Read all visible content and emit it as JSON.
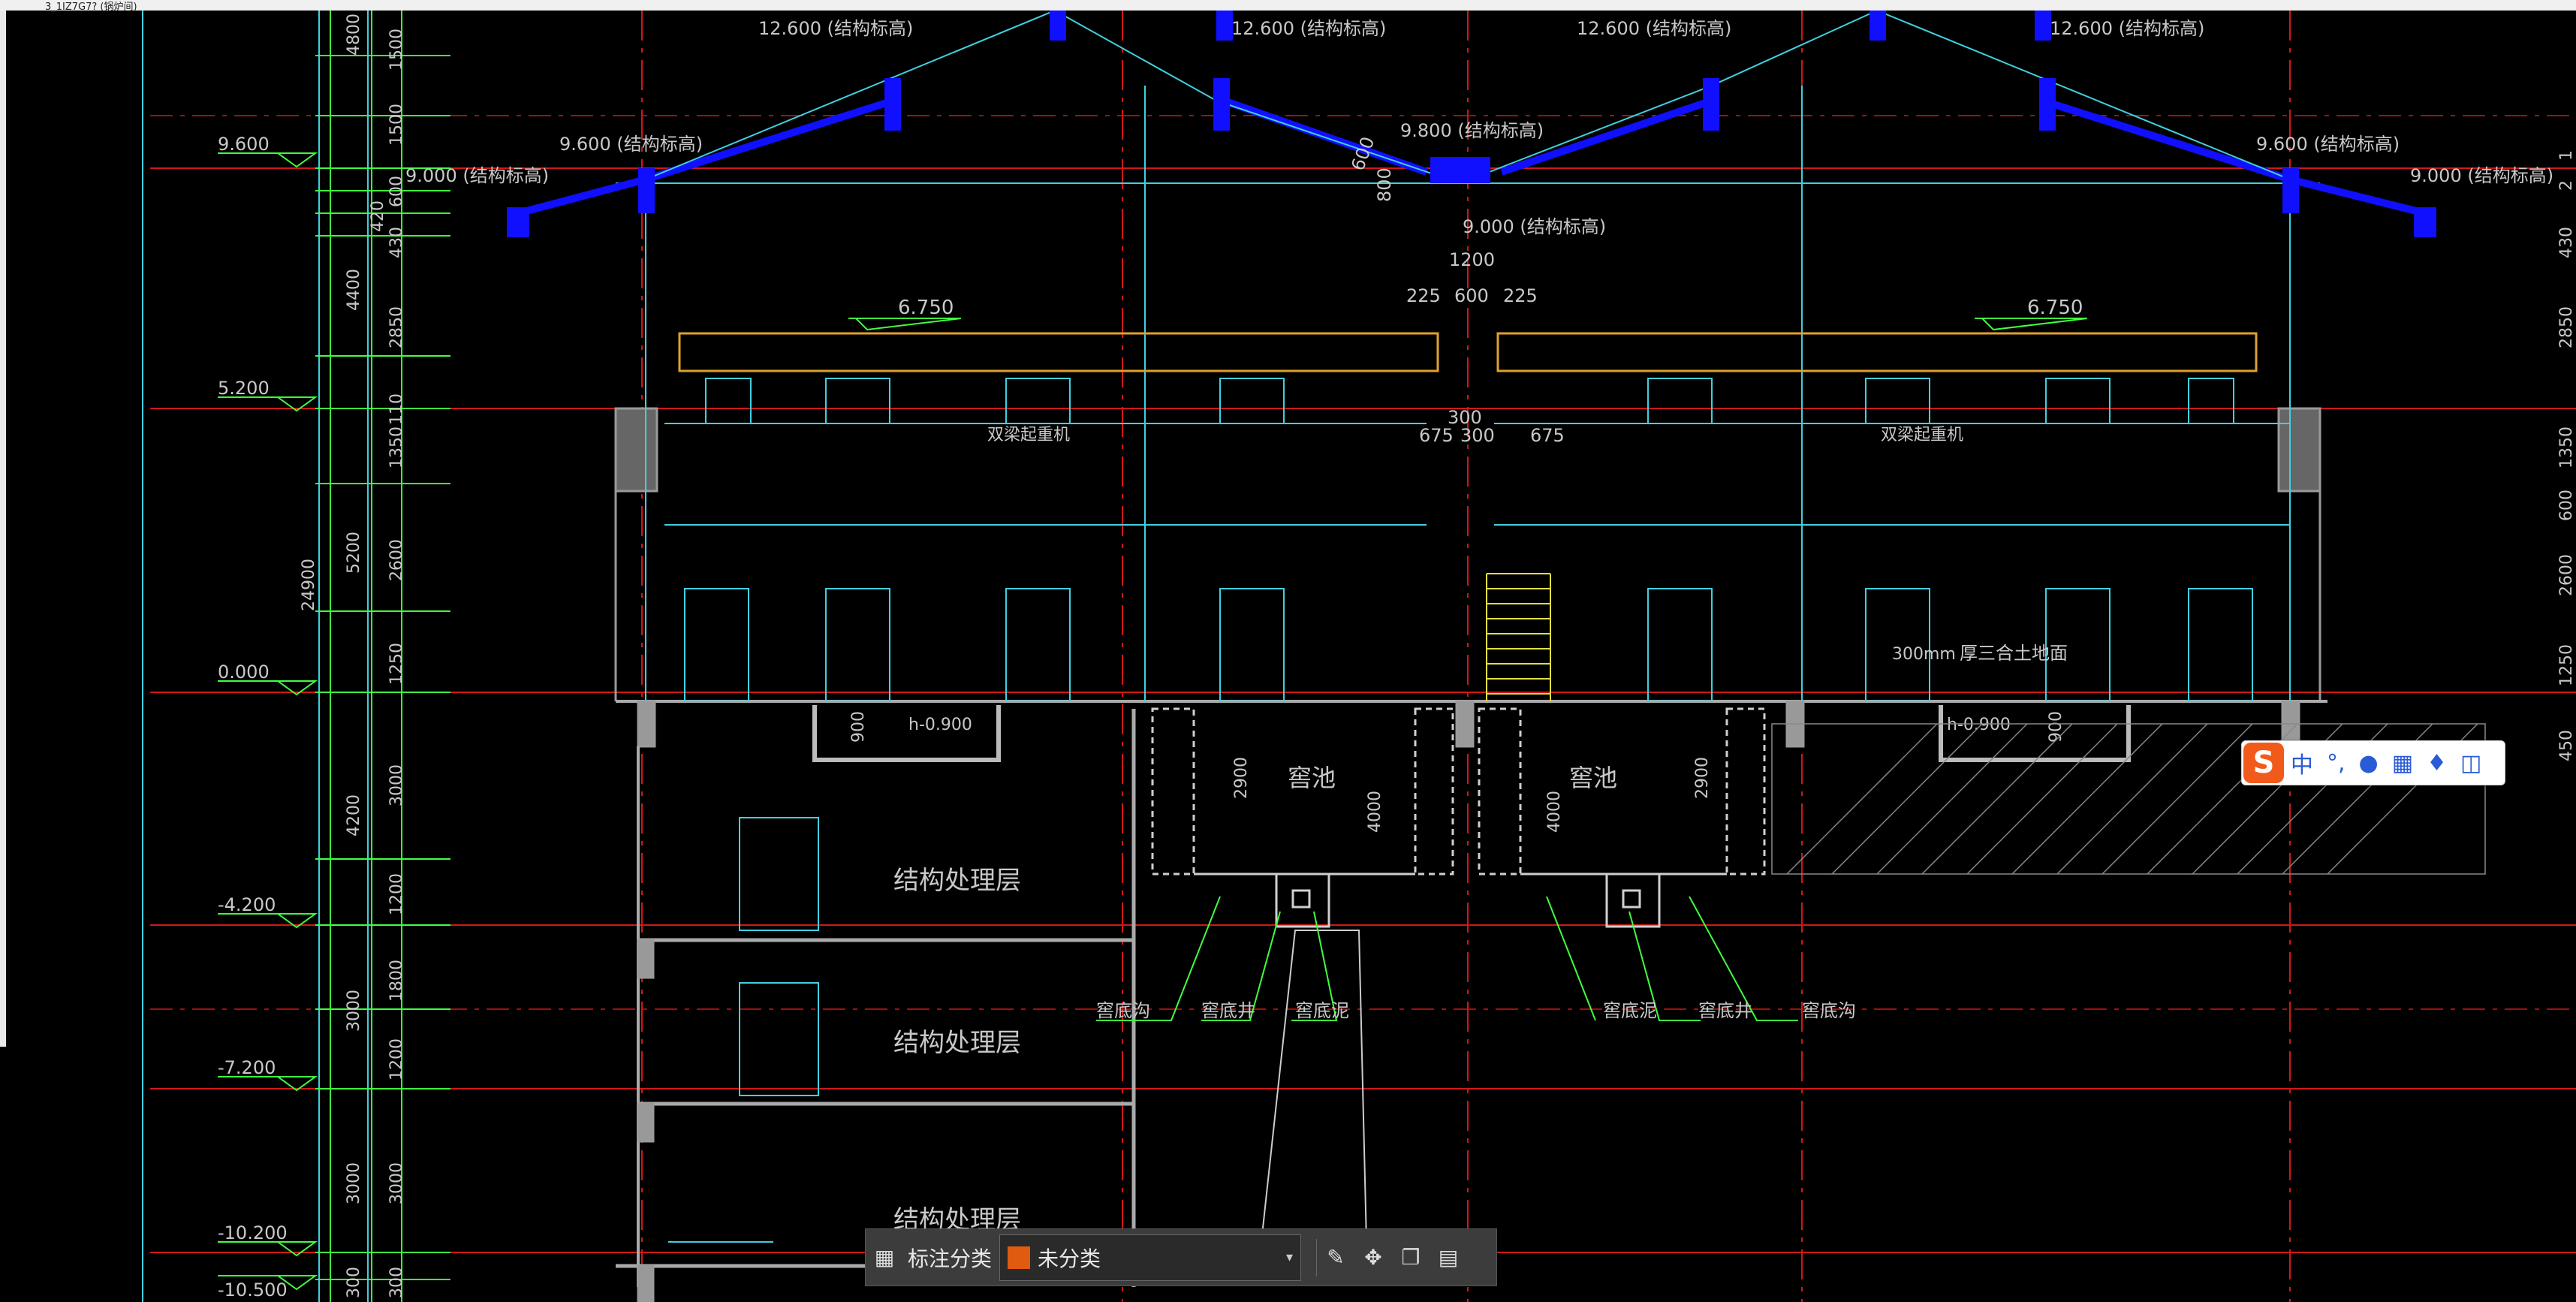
{
  "window": {
    "title": "3_1IZ7G7? (锅炉间)"
  },
  "elevations": {
    "left": [
      "9.600",
      "5.200",
      "0.000",
      "-4.200",
      "-7.200",
      "-10.200",
      "-10.500"
    ]
  },
  "dims": {
    "column_a": [
      "4800",
      "4400",
      "5200",
      "4200",
      "3000",
      "3000",
      "300"
    ],
    "column_b": [
      "1500",
      "1500",
      "600",
      "420",
      "430",
      "2850",
      "110",
      "1350",
      "2600",
      "1250",
      "3000",
      "1200",
      "1800",
      "1200",
      "3000",
      "300"
    ],
    "total": "24900",
    "right_edge": [
      "1",
      "2",
      "430",
      "2850",
      "1350",
      "600",
      "2600",
      "1250",
      "450"
    ]
  },
  "labels": {
    "ridge": "12.600 (结构标高)",
    "eave": "9.600 (结构标高)",
    "eave_low": "9.000 (结构标高)",
    "valley_top": "9.800 (结构标高)",
    "valley_bottom": "9.000 (结构标高)",
    "beam_level": "6.750",
    "crane": "双梁起重机",
    "pit_level": "h-0.900",
    "pit_depth": "900",
    "floor_note_a": "300mm",
    "floor_note_b": "厚三合土地面",
    "kiln": "窖池",
    "kiln_d1": "2900",
    "kiln_d2": "4000",
    "struct_layer": "结构处理层",
    "kiln_ditch": "窖底沟",
    "kiln_well": "窖底井",
    "kiln_mud": "窖底泥",
    "valley_dim1": "1200",
    "valley_dim2": "600",
    "valley_dim3": "225",
    "valley_dim4": "800",
    "col_dim1": "300",
    "col_dim2": "675",
    "slope_dim": "600"
  },
  "toolbar": {
    "category_label": "标注分类",
    "category_value": "未分类",
    "category_color": "#e05a10"
  },
  "ime": {
    "logo": "S",
    "lang": "中",
    "punct": "°,"
  },
  "colors": {
    "background": "#000000",
    "roof": "#1010ff",
    "dim_green": "#40ff40",
    "axis_red": "#d01818",
    "line_cyan": "#40d0e0",
    "line_grey": "#9a9a9a",
    "beam_orange": "#e0a030"
  }
}
